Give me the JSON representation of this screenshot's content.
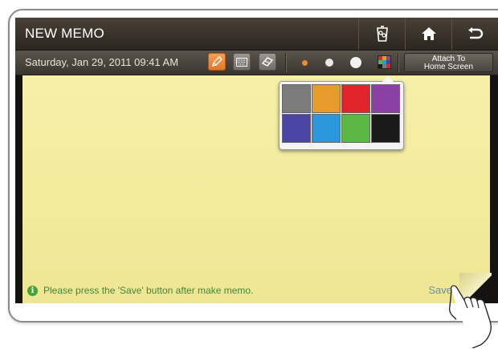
{
  "title": "NEW MEMO",
  "datetime": "Saturday, Jan 29, 2011 09:41 AM",
  "attach": {
    "line1": "Attach To",
    "line2": "Home Screen"
  },
  "notice": "Please press the 'Save' button after make memo.",
  "save_label": "Save",
  "info_icon_glyph": "i",
  "icons": {
    "trash": "trash-icon",
    "home": "home-icon",
    "back": "back-icon",
    "pen": "pen-icon",
    "keyboard": "keyboard-icon",
    "eraser": "eraser-icon",
    "palette": "palette-icon"
  },
  "colors": {
    "accent": "#e98a34",
    "paper": "#f3ec9d",
    "swatches": [
      "#7b7b7b",
      "#e79b2b",
      "#e2252b",
      "#8c3fa5",
      "#4a45a2",
      "#2a98da",
      "#5cb843",
      "#1a1a1a"
    ]
  }
}
